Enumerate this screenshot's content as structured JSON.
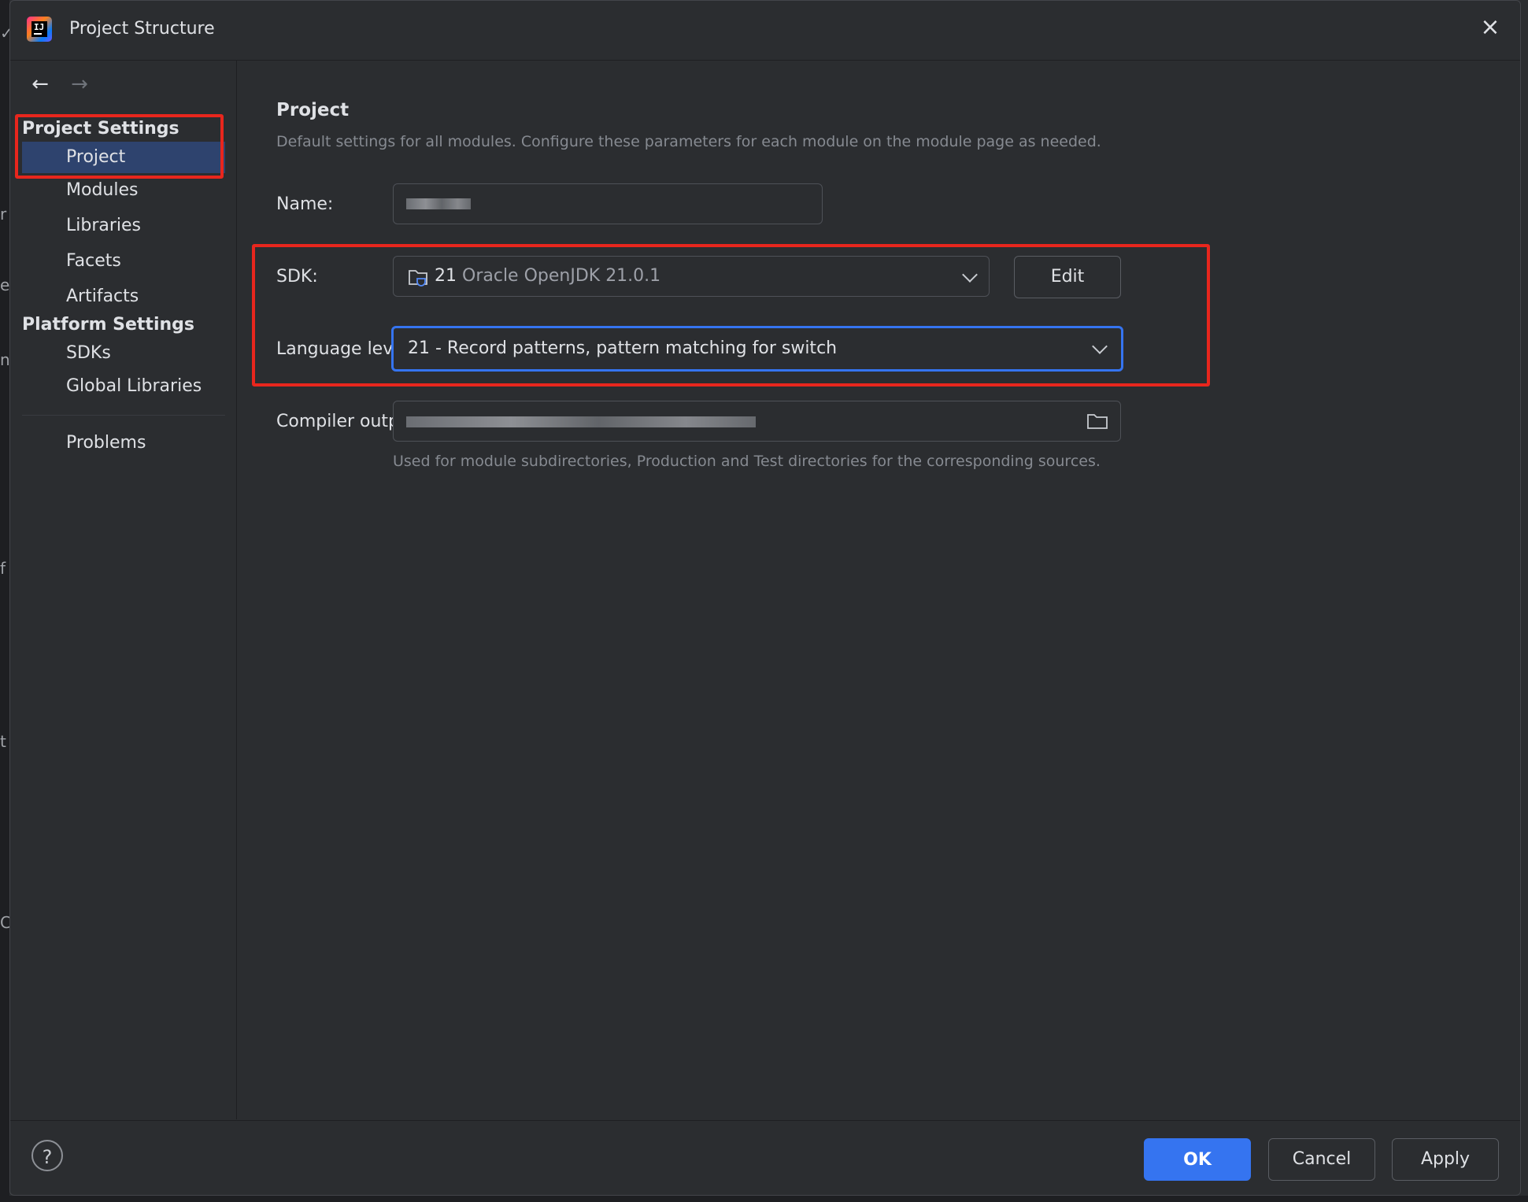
{
  "window": {
    "title": "Project Structure",
    "close_glyph": "×"
  },
  "nav": {
    "back_glyph": "←",
    "forward_glyph": "→"
  },
  "sidebar": {
    "project_settings_header": "Project Settings",
    "project_items": [
      "Project",
      "Modules",
      "Libraries",
      "Facets",
      "Artifacts"
    ],
    "platform_settings_header": "Platform Settings",
    "platform_items": [
      "SDKs",
      "Global Libraries"
    ],
    "problems_label": "Problems",
    "selected_item": "Project"
  },
  "main": {
    "heading": "Project",
    "description": "Default settings for all modules. Configure these parameters for each module on the module page as needed.",
    "name_label": "Name:",
    "sdk_label": "SDK:",
    "sdk_version": "21",
    "sdk_name": "Oracle OpenJDK 21.0.1",
    "edit_button": "Edit",
    "language_level_label": "Language level:",
    "language_level_value": "21 - Record patterns, pattern matching for switch",
    "compiler_output_label": "Compiler output:",
    "compiler_output_hint": "Used for module subdirectories, Production and Test directories for the corresponding sources."
  },
  "footer": {
    "help_glyph": "?",
    "ok": "OK",
    "cancel": "Cancel",
    "apply": "Apply"
  },
  "colors": {
    "accent": "#3574f0",
    "highlight_box": "#e8261d",
    "selection": "#2e436e",
    "background": "#2b2d30"
  },
  "icons": [
    "intellij-logo-icon",
    "close-icon",
    "back-arrow-icon",
    "forward-arrow-icon",
    "sdk-folder-icon",
    "chevron-down-icon",
    "folder-icon",
    "help-icon"
  ]
}
